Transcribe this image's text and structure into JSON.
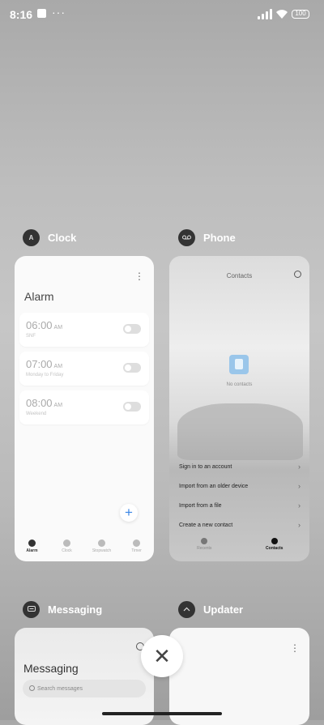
{
  "status_bar": {
    "time": "8:16",
    "more": "···",
    "battery": "100"
  },
  "apps": {
    "clock": {
      "name": "Clock",
      "title": "Alarm",
      "alarms": [
        {
          "time": "06:00",
          "ampm": "AM",
          "label": "SNF",
          "enabled": false
        },
        {
          "time": "07:00",
          "ampm": "AM",
          "label": "Monday to Friday",
          "enabled": false
        },
        {
          "time": "08:00",
          "ampm": "AM",
          "label": "Weekend",
          "enabled": false
        }
      ],
      "add": "+",
      "tabs": [
        "Alarm",
        "Clock",
        "Stopwatch",
        "Timer"
      ],
      "active_tab": "Alarm"
    },
    "phone": {
      "name": "Phone",
      "title": "Contacts",
      "empty": "No contacts",
      "menu": [
        "Sign in to an account",
        "Import from an older device",
        "Import from a file",
        "Create a new contact"
      ],
      "tabs": [
        "Recents",
        "Contacts"
      ],
      "active_tab": "Contacts"
    },
    "messaging": {
      "name": "Messaging",
      "title": "Messaging",
      "search_placeholder": "Search messages"
    },
    "updater": {
      "name": "Updater"
    }
  },
  "close_label": "✕",
  "colors": {
    "accent": "#3a86e6"
  }
}
